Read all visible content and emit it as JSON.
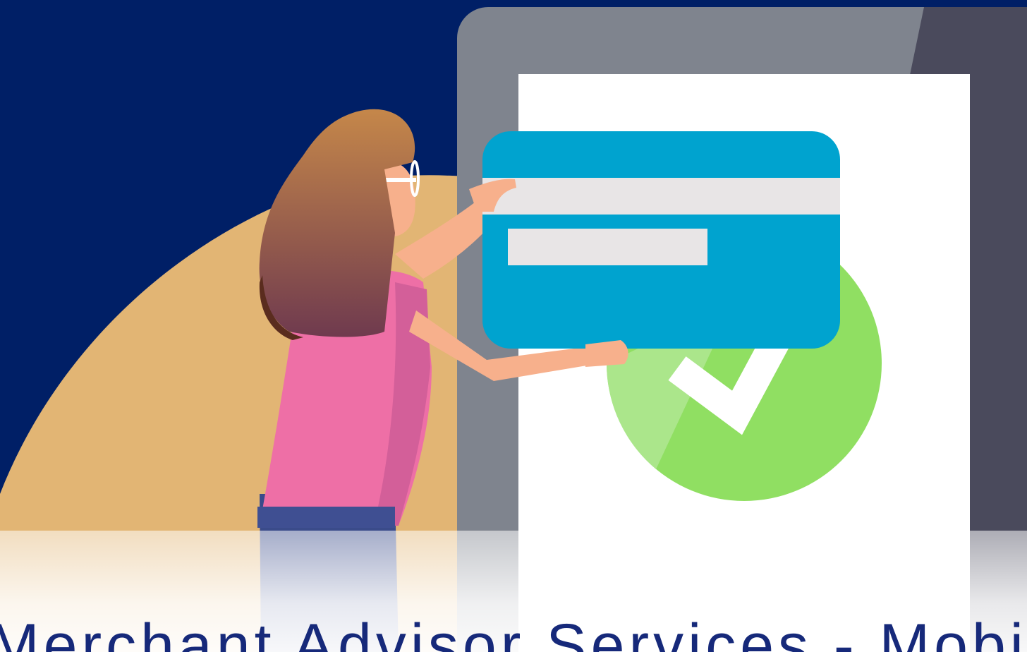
{
  "banner": {
    "caption": "Merchant Advisor Services - Mobile Payments"
  },
  "colors": {
    "background": "#001f66",
    "tablet_frame": "#7f848e",
    "tablet_shadow": "#4a4a5c",
    "card": "#00a3cf",
    "card_stripe": "#e8e5e6",
    "check_circle": "#90df62",
    "hair": "#9a5a44",
    "shirt": "#ee6fa6",
    "skin": "#f7b08c",
    "backdrop_shape": "#e2b574",
    "caption_text": "#16297a"
  },
  "icons": [
    "credit-card-icon",
    "checkmark-icon",
    "tablet-icon"
  ]
}
